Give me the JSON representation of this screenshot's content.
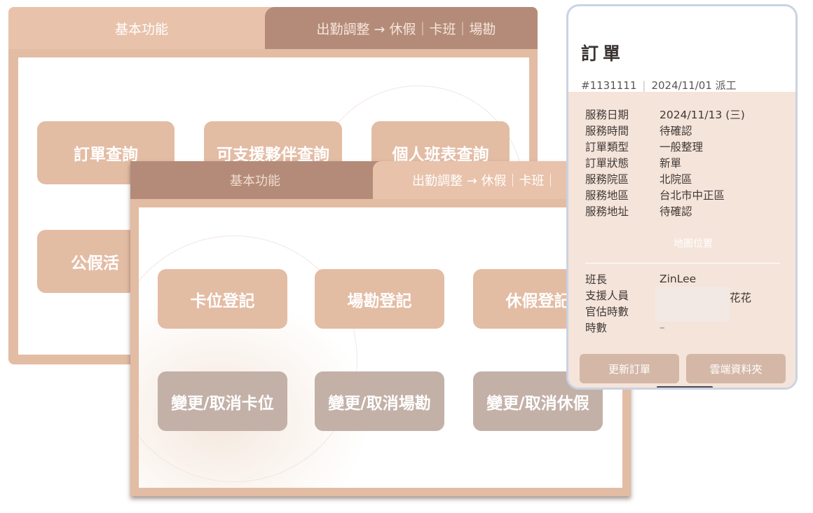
{
  "back_panel": {
    "tab_basic": "基本功能",
    "tab_attendance": "出勤調整 → 休假｜卡班｜場勘",
    "buttons": {
      "order_query": "訂單查詢",
      "partner_query": "可支援夥伴查詢",
      "schedule_query": "個人班表查詢",
      "leave_activity": "公假活"
    }
  },
  "front_panel": {
    "tab_basic": "基本功能",
    "tab_attendance": "出勤調整 → 休假｜卡班｜",
    "buttons": {
      "slot_register": "卡位登記",
      "survey_register": "場勘登記",
      "leave_register": "休假登記",
      "change_slot": "變更/取消卡位",
      "change_survey": "變更/取消場勘",
      "change_leave": "變更/取消休假"
    }
  },
  "order_card": {
    "title": "訂單",
    "order_no": "#1131111",
    "dispatch": "2024/11/01 派工",
    "fields": [
      {
        "label": "服務日期",
        "value": "2024/11/13 (三)"
      },
      {
        "label": "服務時間",
        "value": "待確認"
      },
      {
        "label": "訂單類型",
        "value": "一般整理"
      },
      {
        "label": "訂單狀態",
        "value": "新單"
      },
      {
        "label": "服務院區",
        "value": "北院區"
      },
      {
        "label": "服務地區",
        "value": "台北市中正區"
      },
      {
        "label": "服務地址",
        "value": "待確認"
      }
    ],
    "map_link": "地圖位置",
    "staff": [
      {
        "label": "班長",
        "value": "ZinLee"
      },
      {
        "label": "支援人員",
        "value": ""
      },
      {
        "label": "官估時數",
        "value": ""
      },
      {
        "label": "時數",
        "value": "–"
      }
    ],
    "support_name": "花花",
    "update_button": "更新訂單",
    "cloud_button": "雲端資料夾"
  }
}
